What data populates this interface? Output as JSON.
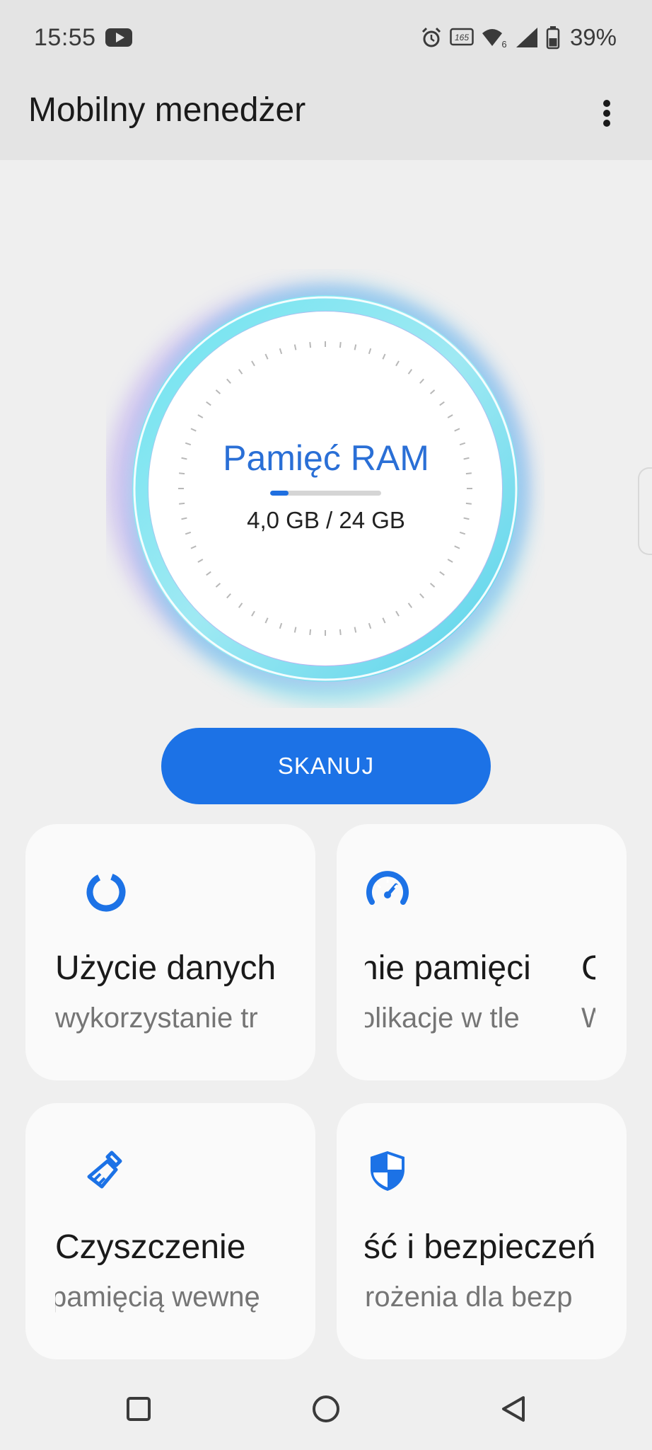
{
  "status_bar": {
    "time": "15:55",
    "battery_percent": "39%",
    "refresh_rate": "165",
    "icons": [
      "youtube-icon",
      "alarm-icon",
      "refresh-rate-icon",
      "wifi-6-icon",
      "signal-icon",
      "battery-icon"
    ]
  },
  "app_bar": {
    "title": "Mobilny menedżer",
    "menu_icon": "more-vert-icon"
  },
  "ram": {
    "title": "Pamięć RAM",
    "value_text": "4,0 GB / 24 GB",
    "used_gb": 4.0,
    "total_gb": 24,
    "used_fraction": 0.167
  },
  "scan_button": {
    "label": "SKANUJ"
  },
  "cards": [
    {
      "icon": "data-usage-icon",
      "title": "Użycie danych",
      "subtitle": "wykorzystanie tr"
    },
    {
      "icon": "speedometer-icon",
      "title": "nie pamięci",
      "subtitle": "olikacje w tle",
      "next_title": "C",
      "next_subtitle": "W"
    },
    {
      "icon": "broom-icon",
      "title": "Czyszczenie",
      "subtitle": "pamięcią wewnę"
    },
    {
      "icon": "shield-icon",
      "title": "ść i bezpieczeń",
      "subtitle": "rożenia dla bezp"
    }
  ],
  "colors": {
    "accent": "#1c72e6",
    "ram_title": "#2a6fd6",
    "background": "#efefef",
    "card": "#fafafa"
  }
}
